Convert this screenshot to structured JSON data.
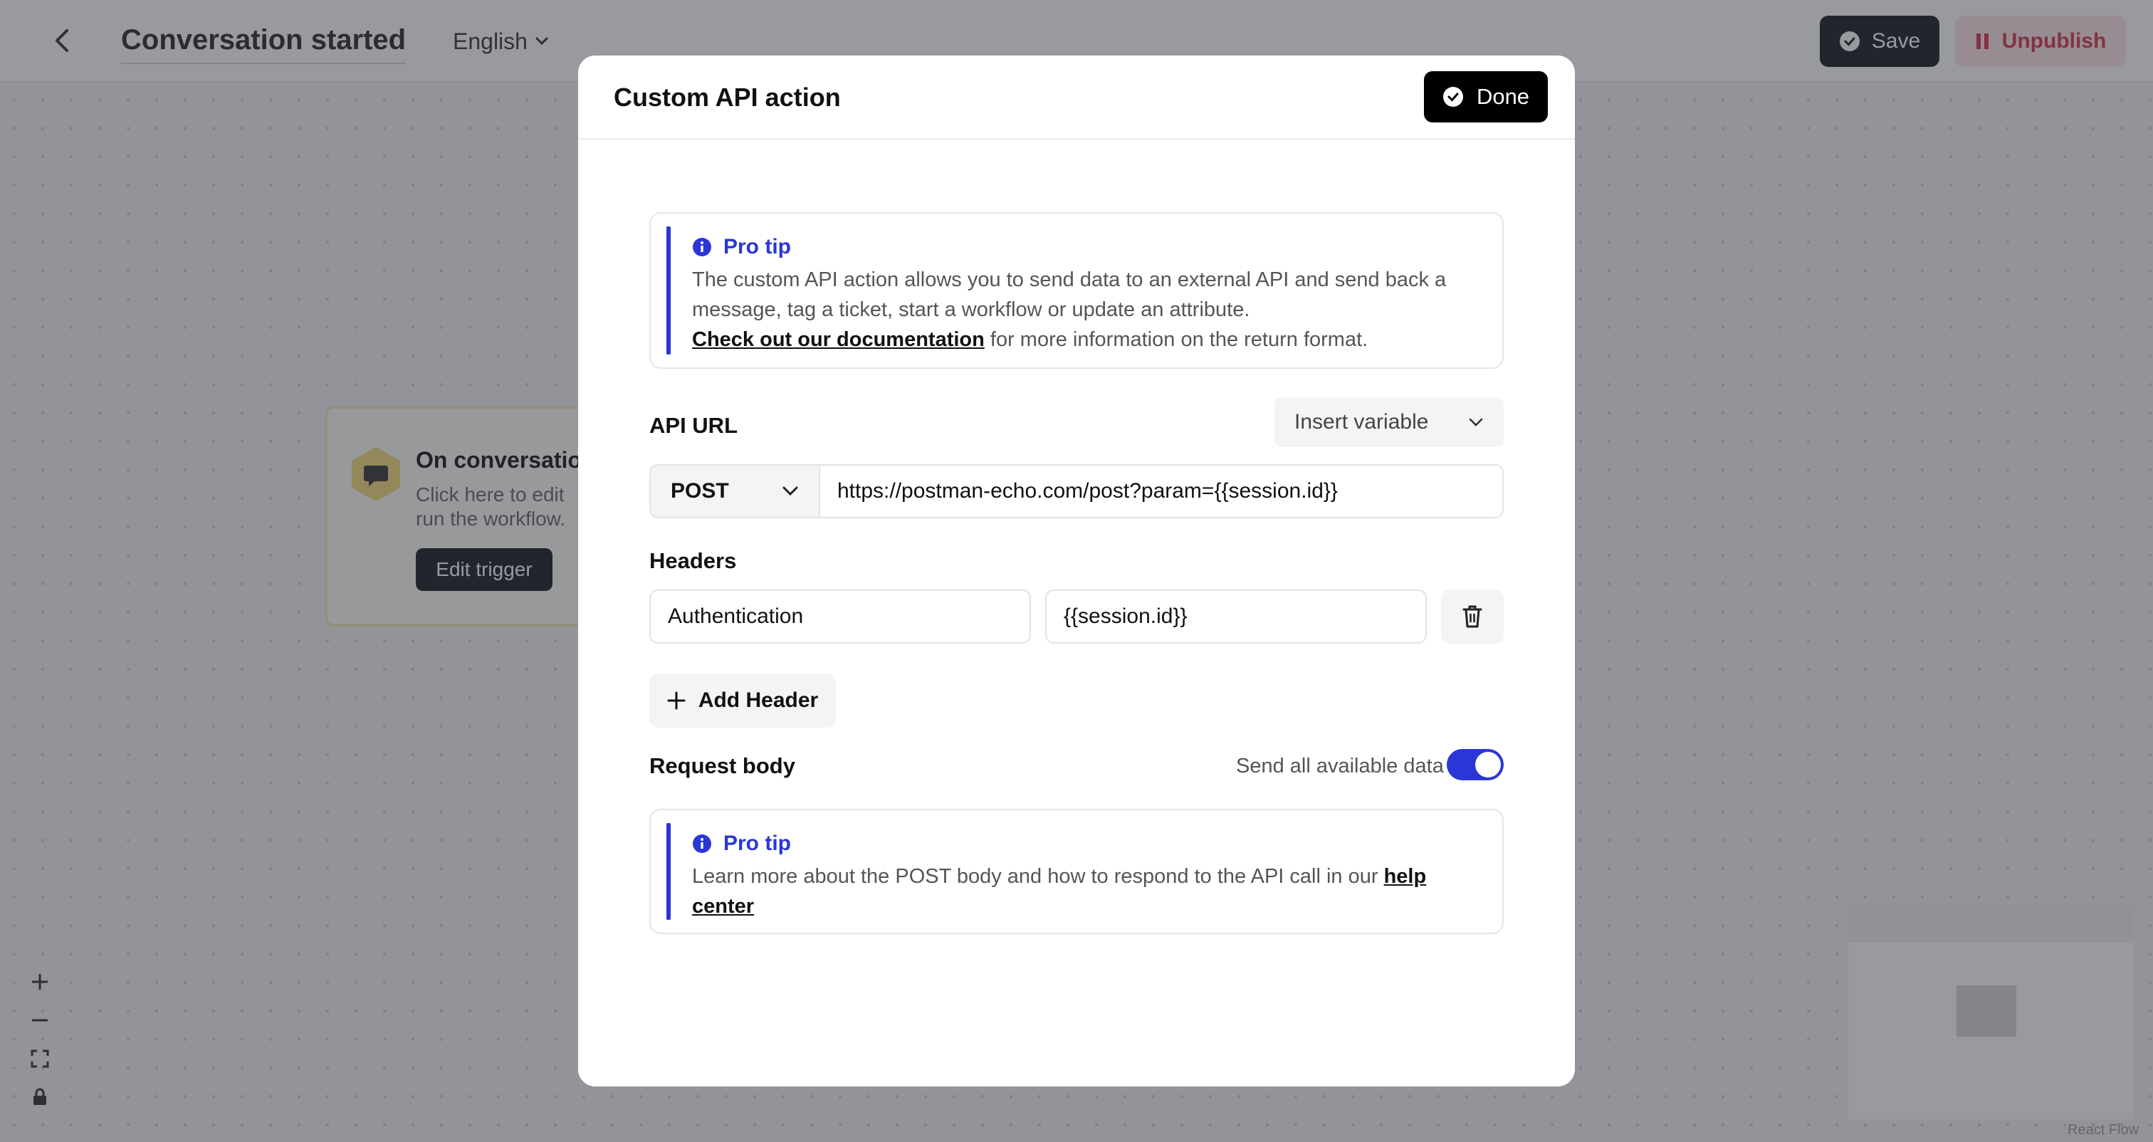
{
  "topbar": {
    "title": "Conversation started",
    "language": "English",
    "save_label": "Save",
    "unpublish_label": "Unpublish"
  },
  "trigger": {
    "title": "On conversation",
    "desc_line1": "Click here to edit",
    "desc_line2": "run the workflow.",
    "edit_label": "Edit trigger"
  },
  "footer": {
    "attribution": "React Flow"
  },
  "modal": {
    "title": "Custom API action",
    "done_label": "Done",
    "tip1": {
      "title": "Pro tip",
      "text": "The custom API action allows you to send data to an external API and send back a message, tag a ticket, start a workflow or update an attribute.",
      "link": "Check out our documentation",
      "text_after": " for more information on the return format."
    },
    "api_url": {
      "label": "API URL",
      "insert_variable": "Insert variable",
      "method": "POST",
      "url": "https://postman-echo.com/post?param={{session.id}}"
    },
    "headers": {
      "label": "Headers",
      "key": "Authentication",
      "value": "{{session.id}}",
      "add_label": "Add Header"
    },
    "request_body": {
      "label": "Request body",
      "toggle_label": "Send all available data",
      "toggle_on": true
    },
    "tip2": {
      "title": "Pro tip",
      "text": "Learn more about the POST body and how to respond to the API call in our ",
      "link": "help center"
    }
  },
  "colors": {
    "accent": "#2a37d6",
    "primary_button": "#000000",
    "danger": "#d9394a"
  }
}
